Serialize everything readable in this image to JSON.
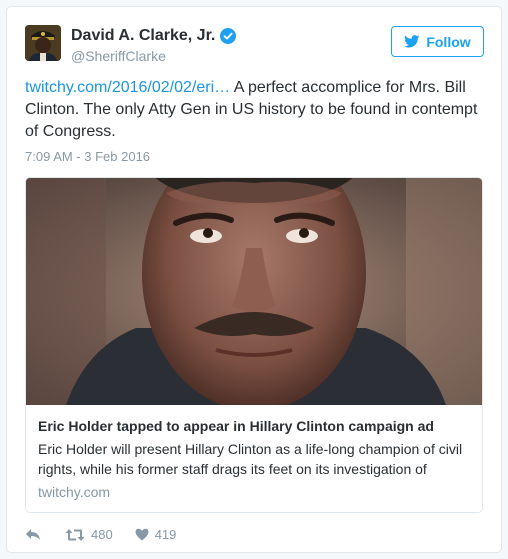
{
  "author": {
    "name": "David A. Clarke, Jr.",
    "handle": "@SheriffClarke"
  },
  "follow_button": {
    "label": "Follow",
    "icon": "bird-icon"
  },
  "tweet": {
    "link_text": "twitchy.com/2016/02/02/eri…",
    "text": " A perfect accomplice for Mrs. Bill Clinton. The only Atty Gen in US history to be found in contempt of Congress.",
    "timestamp": "7:09 AM - 3 Feb 2016"
  },
  "link_card": {
    "title": "Eric Holder tapped to appear in Hillary Clinton campaign ad",
    "description": "Eric Holder will present Hillary Clinton as a life-long champion of civil rights, while his former staff drags its feet on its investigation of",
    "domain": "twitchy.com"
  },
  "actions": {
    "reply_icon": "reply-icon",
    "retweet_icon": "retweet-icon",
    "retweets": "480",
    "like_icon": "heart-icon",
    "likes": "419"
  },
  "colors": {
    "accent": "#1da1f2",
    "link": "#1b95e0",
    "muted": "#8899a6",
    "text": "#292f33",
    "border": "#e1e8ed"
  }
}
